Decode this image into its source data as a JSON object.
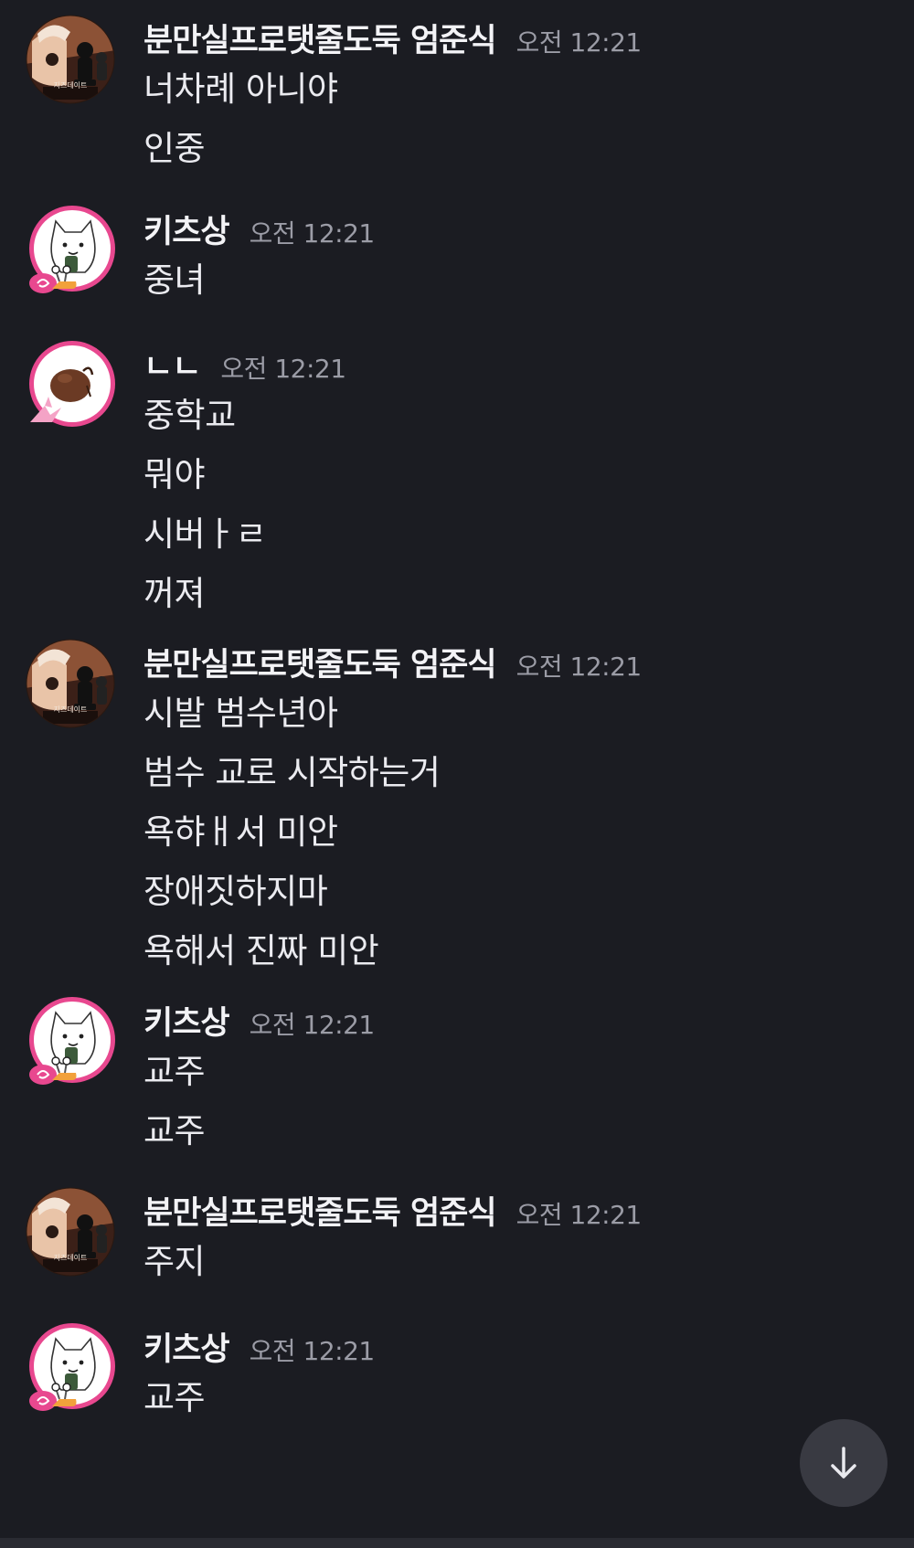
{
  "groups": [
    {
      "username": "분만실프로탯줄도둑 엄준식",
      "avatar": "chess-character-avatar",
      "avatar_caption": "지즈데이트",
      "time": "오전 12:21",
      "lines": [
        "너차례 아니야",
        "인중"
      ]
    },
    {
      "username": "키츠상",
      "avatar": "white-cat-snail-avatar",
      "time": "오전 12:21",
      "lines": [
        "중녀"
      ]
    },
    {
      "username": "ㄴㄴ",
      "avatar": "brown-creature-crane-avatar",
      "time": "오전 12:21",
      "lines": [
        "중학교",
        "뭐야",
        "시버ㅏㄹ",
        "꺼져"
      ]
    },
    {
      "username": "분만실프로탯줄도둑 엄준식",
      "avatar": "chess-character-avatar",
      "avatar_caption": "지즈데이트",
      "time": "오전 12:21",
      "lines": [
        "시발 범수년아",
        "범수 교로 시작하는거",
        "욕햐ㅐ서 미안",
        "장애짓하지마",
        "욕해서 진짜 미안"
      ]
    },
    {
      "username": "키츠상",
      "avatar": "white-cat-snail-avatar",
      "time": "오전 12:21",
      "lines": [
        "교주",
        "교주"
      ]
    },
    {
      "username": "분만실프로탯줄도둑 엄준식",
      "avatar": "chess-character-avatar",
      "avatar_caption": "지즈데이트",
      "time": "오전 12:21",
      "lines": [
        "주지"
      ]
    },
    {
      "username": "키츠상",
      "avatar": "white-cat-snail-avatar",
      "time": "오전 12:21",
      "lines": [
        "교주"
      ]
    }
  ],
  "scroll_button": {
    "icon": "arrow-down-icon"
  },
  "colors": {
    "background": "#1b1c22",
    "text": "#ebebf0",
    "timestamp": "#9b9ca6",
    "scroll_button": "#393a42"
  }
}
